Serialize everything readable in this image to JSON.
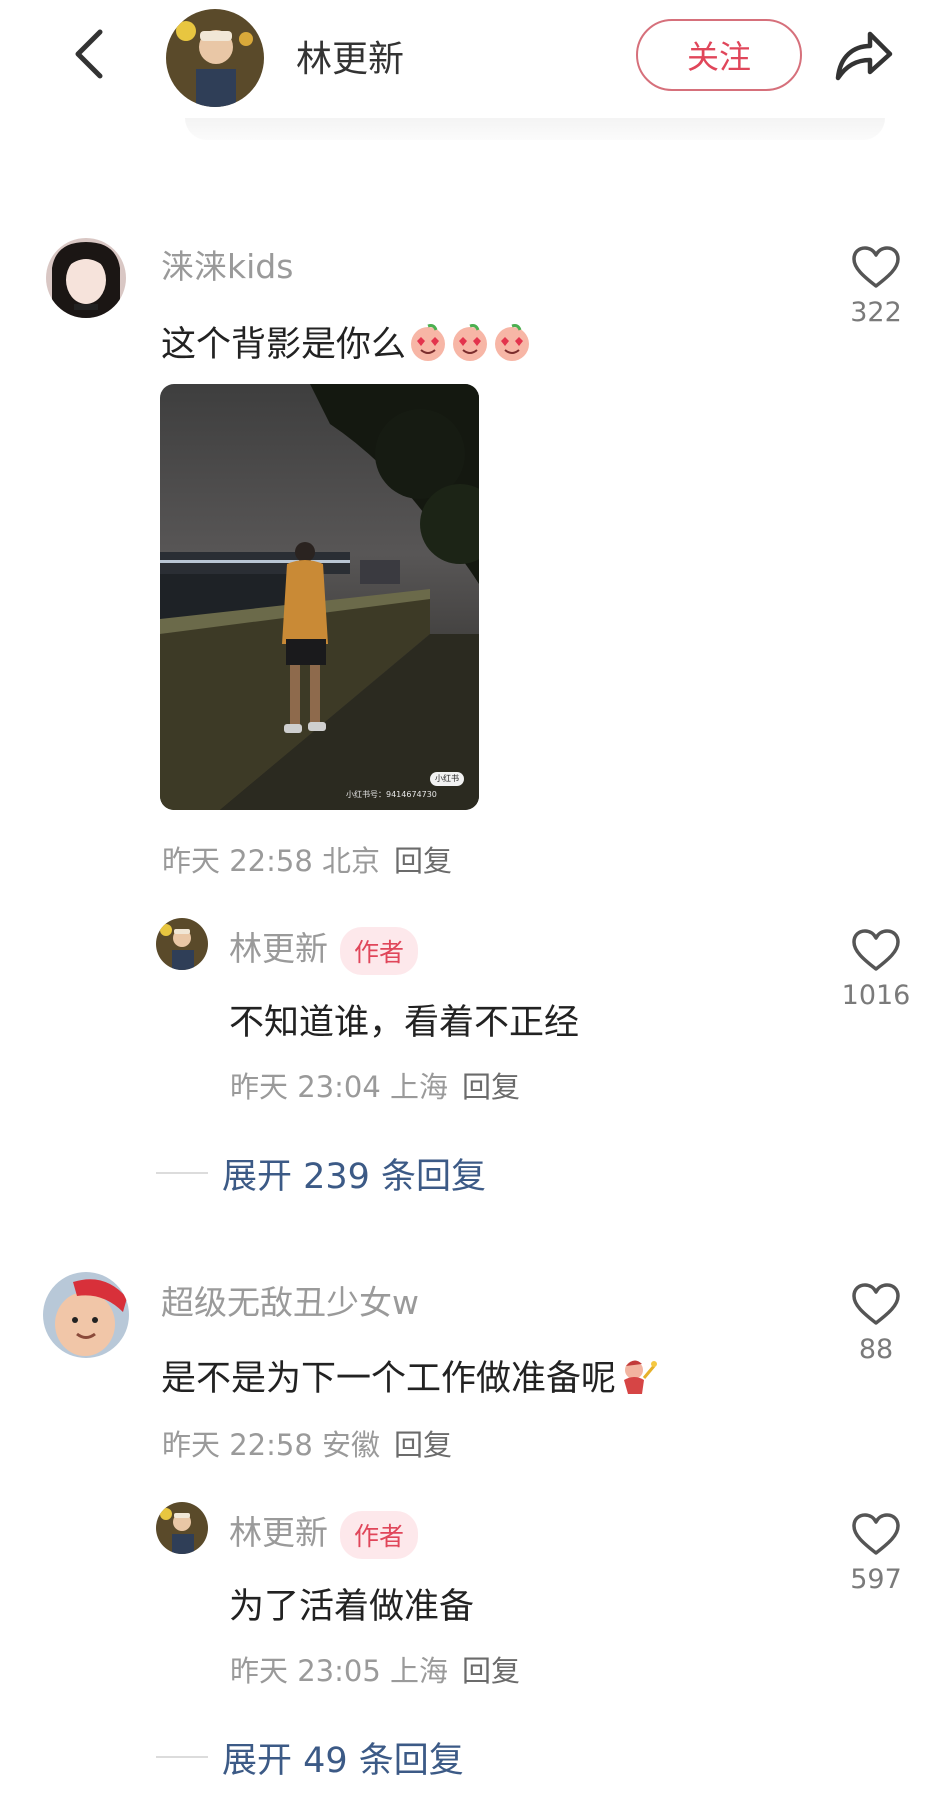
{
  "header": {
    "username": "林更新",
    "follow_label": "关注"
  },
  "comments": [
    {
      "username": "涞涞kids",
      "text": "这个背影是你么",
      "time": "昨天 22:58",
      "location": "北京",
      "reply_label": "回复",
      "likes": "322",
      "image_watermark_logo": "小红书",
      "image_watermark_id": "小红书号：9414674730",
      "replies": [
        {
          "username": "林更新",
          "tag": "作者",
          "text": "不知道谁，看着不正经",
          "time": "昨天 23:04",
          "location": "上海",
          "reply_label": "回复",
          "likes": "1016"
        }
      ],
      "expand_label": "展开 239 条回复"
    },
    {
      "username": "超级无敌丑少女w",
      "text": "是不是为下一个工作做准备呢",
      "time": "昨天 22:58",
      "location": "安徽",
      "reply_label": "回复",
      "likes": "88",
      "replies": [
        {
          "username": "林更新",
          "tag": "作者",
          "text": "为了活着做准备",
          "time": "昨天 23:05",
          "location": "上海",
          "reply_label": "回复",
          "likes": "597"
        }
      ],
      "expand_label": "展开 49 条回复"
    }
  ],
  "icons": {
    "back": "chevron-left-icon",
    "share": "share-arrow-icon",
    "like": "heart-outline-icon",
    "emoji_1": "heart-eyes-peach-emoji",
    "emoji_2": "dancing-figure-emoji"
  },
  "colors": {
    "accent": "#e0465a",
    "expand_link": "#3c5a86",
    "secondary_text": "#9a9a9a"
  }
}
